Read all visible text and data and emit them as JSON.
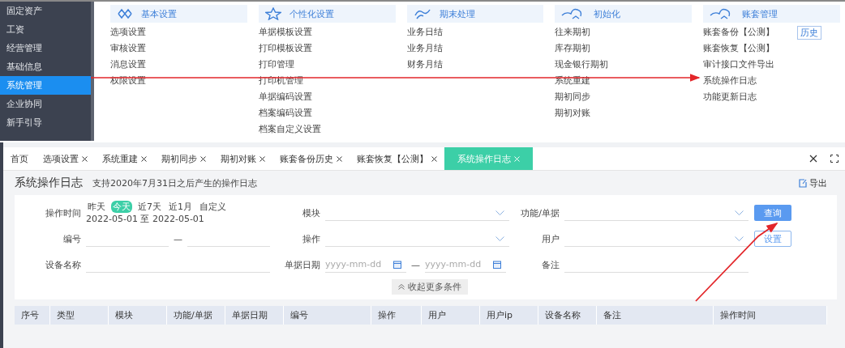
{
  "sidebar": {
    "items": [
      {
        "label": "固定资产",
        "selected": false
      },
      {
        "label": "工资",
        "selected": false
      },
      {
        "label": "经营管理",
        "selected": false
      },
      {
        "label": "基础信息",
        "selected": false
      },
      {
        "label": "系统管理",
        "selected": true
      },
      {
        "label": "企业协同",
        "selected": false
      },
      {
        "label": "新手引导",
        "selected": false
      }
    ]
  },
  "menu": {
    "columns": [
      {
        "title": "基本设置",
        "items": [
          {
            "label": "选项设置"
          },
          {
            "label": "审核设置"
          },
          {
            "label": "消息设置"
          },
          {
            "label": "权限设置"
          }
        ]
      },
      {
        "title": "个性化设置",
        "items": [
          {
            "label": "单据模板设置"
          },
          {
            "label": "打印模板设置"
          },
          {
            "label": "打印管理"
          },
          {
            "label": "打印机管理"
          },
          {
            "label": "单据编码设置"
          },
          {
            "label": "档案编码设置"
          },
          {
            "label": "档案自定义设置"
          }
        ]
      },
      {
        "title": "期末处理",
        "items": [
          {
            "label": "业务日结"
          },
          {
            "label": "业务月结"
          },
          {
            "label": "财务月结"
          }
        ]
      },
      {
        "title": "初始化",
        "items": [
          {
            "label": "往来期初"
          },
          {
            "label": "库存期初"
          },
          {
            "label": "现金银行期初"
          },
          {
            "label": "系统重建"
          },
          {
            "label": "期初同步"
          },
          {
            "label": "期初对账"
          }
        ]
      },
      {
        "title": "账套管理",
        "items": [
          {
            "label": "账套备份【公测】",
            "button": "历史"
          },
          {
            "label": "账套恢复【公测】"
          },
          {
            "label": "审计接口文件导出"
          },
          {
            "label": "系统操作日志"
          },
          {
            "label": "功能更新日志"
          }
        ]
      }
    ]
  },
  "tabs": [
    {
      "label": "首页",
      "closable": false,
      "selected": false
    },
    {
      "label": "选项设置",
      "closable": true,
      "selected": false
    },
    {
      "label": "系统重建",
      "closable": true,
      "selected": false
    },
    {
      "label": "期初同步",
      "closable": true,
      "selected": false
    },
    {
      "label": "期初对账",
      "closable": true,
      "selected": false
    },
    {
      "label": "账套备份历史",
      "closable": true,
      "selected": false
    },
    {
      "label": "账套恢复【公测】",
      "closable": true,
      "selected": false
    },
    {
      "label": "系统操作日志",
      "closable": true,
      "selected": true
    }
  ],
  "page": {
    "title": "系统操作日志",
    "subtitle": "支持2020年7月31日之后产生的操作日志",
    "export": "导出"
  },
  "filters": [
    {
      "kind": "quick",
      "label": "操作时间",
      "options": [
        {
          "label": "昨天",
          "selected": false
        },
        {
          "label": "今天",
          "selected": true
        },
        {
          "label": "近7天",
          "selected": false
        },
        {
          "label": "近1月",
          "selected": false
        },
        {
          "label": "自定义",
          "selected": false
        }
      ],
      "range": "2022-05-01 至 2022-05-01"
    },
    {
      "kind": "select",
      "label": "模块"
    },
    {
      "kind": "select",
      "label": "功能/单据"
    },
    {
      "kind": "range",
      "label": "编号",
      "separator": "—"
    },
    {
      "kind": "select",
      "label": "操作"
    },
    {
      "kind": "select",
      "label": "用户"
    },
    {
      "kind": "text",
      "label": "设备名称"
    },
    {
      "kind": "date_range",
      "label": "单据日期",
      "placeholder_from": "yyyy-mm-dd",
      "separator": "—",
      "placeholder_to": "yyyy-mm-dd"
    },
    {
      "kind": "text",
      "label": "备注"
    }
  ],
  "buttons": [
    {
      "label": "查询",
      "kind": "primary"
    },
    {
      "label": "设置",
      "kind": "outline"
    }
  ],
  "collapse": "收起更多条件",
  "table": {
    "columns": [
      "序号",
      "类型",
      "模块",
      "功能/单据",
      "单据日期",
      "编号",
      "操作",
      "用户",
      "用户ip",
      "设备名称",
      "备注",
      "操作时间"
    ]
  }
}
